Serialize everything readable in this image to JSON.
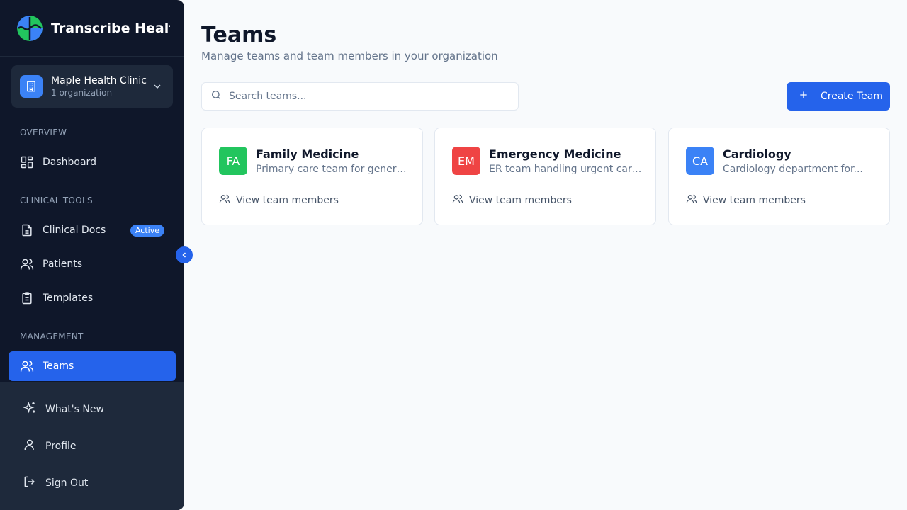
{
  "app": {
    "title": "Transcribe Healt"
  },
  "org": {
    "name": "Maple Health Clinic",
    "sub": "1 organization"
  },
  "sections": {
    "overview": "OVERVIEW",
    "clinical": "CLINICAL TOOLS",
    "management": "MANAGEMENT"
  },
  "nav": {
    "dashboard": "Dashboard",
    "clinical_docs": "Clinical Docs",
    "clinical_docs_badge": "Active",
    "patients": "Patients",
    "templates": "Templates",
    "teams": "Teams"
  },
  "bottom": {
    "whats_new": "What's New",
    "profile": "Profile",
    "sign_out": "Sign Out"
  },
  "page": {
    "title": "Teams",
    "subtitle": "Manage teams and team members in your organization",
    "search_placeholder": "Search teams...",
    "create_label": "Create Team"
  },
  "teams": [
    {
      "initials": "FA",
      "name": "Family Medicine",
      "description": "Primary care team for general...",
      "link": "View team members",
      "color": "#22c55e"
    },
    {
      "initials": "EM",
      "name": "Emergency Medicine",
      "description": "ER team handling urgent care...",
      "link": "View team members",
      "color": "#ef4444"
    },
    {
      "initials": "CA",
      "name": "Cardiology",
      "description": "Cardiology department for...",
      "link": "View team members",
      "color": "#3b82f6"
    }
  ],
  "colors": {
    "accent": "#2563eb",
    "sidebar": "#0f172a",
    "sidebar_bottom": "#1e293b"
  },
  "icons": [
    "logo-icon",
    "building-icon",
    "chevron-down-icon",
    "grid-icon",
    "file-icon",
    "users-icon",
    "clipboard-icon",
    "sparkles-icon",
    "user-icon",
    "logout-icon",
    "chevron-left-icon",
    "search-icon",
    "plus-icon"
  ]
}
